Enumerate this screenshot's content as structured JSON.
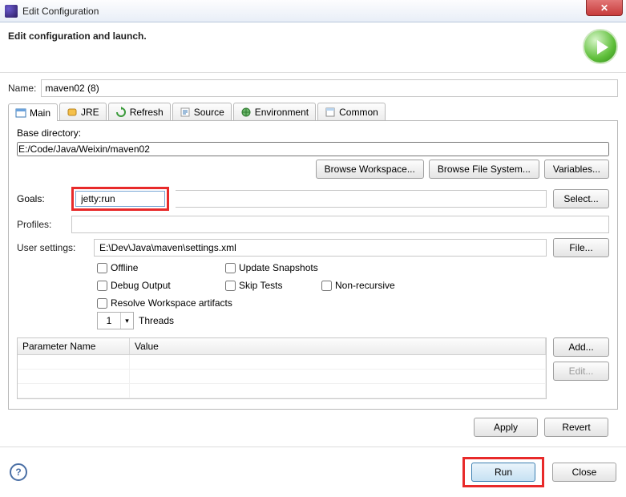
{
  "window": {
    "title": "Edit Configuration"
  },
  "header": {
    "subtitle": "Edit configuration and launch."
  },
  "name": {
    "label": "Name:",
    "value": "maven02 (8)"
  },
  "tabs": [
    {
      "label": "Main"
    },
    {
      "label": "JRE"
    },
    {
      "label": "Refresh"
    },
    {
      "label": "Source"
    },
    {
      "label": "Environment"
    },
    {
      "label": "Common"
    }
  ],
  "base": {
    "label": "Base directory:",
    "value": "E:/Code/Java/Weixin/maven02",
    "browse_workspace": "Browse Workspace...",
    "browse_fs": "Browse File System...",
    "variables": "Variables..."
  },
  "goals": {
    "label": "Goals:",
    "value": "jetty:run",
    "select": "Select..."
  },
  "profiles": {
    "label": "Profiles:",
    "value": ""
  },
  "usersettings": {
    "label": "User settings:",
    "value": "E:\\Dev\\Java\\maven\\settings.xml",
    "file": "File..."
  },
  "checks": {
    "offline": "Offline",
    "update": "Update Snapshots",
    "debug": "Debug Output",
    "skip": "Skip Tests",
    "nonrec": "Non-recursive",
    "resolve": "Resolve Workspace artifacts"
  },
  "threads": {
    "value": "1",
    "label": "Threads"
  },
  "params": {
    "col1": "Parameter Name",
    "col2": "Value",
    "add": "Add...",
    "edit": "Edit..."
  },
  "actions": {
    "apply": "Apply",
    "revert": "Revert"
  },
  "footer": {
    "run": "Run",
    "close": "Close"
  }
}
